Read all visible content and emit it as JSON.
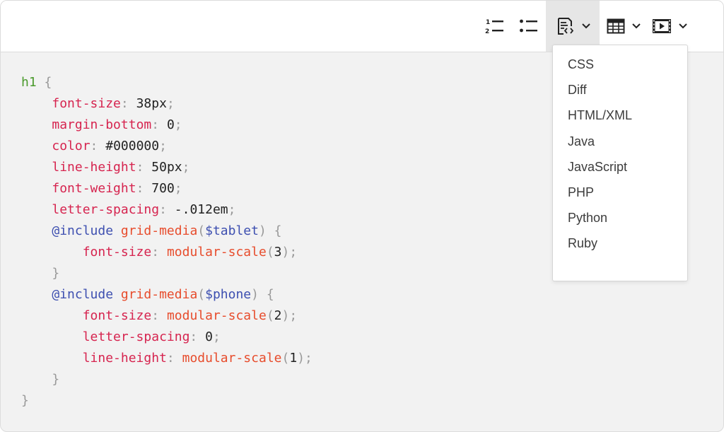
{
  "toolbar": {
    "buttons": [
      {
        "name": "numbered-list",
        "icon": "numbered-list-icon"
      },
      {
        "name": "bulleted-list",
        "icon": "bulleted-list-icon"
      },
      {
        "name": "code-block",
        "icon": "code-block-icon",
        "active": true,
        "dropdown": true
      },
      {
        "name": "table",
        "icon": "table-icon",
        "dropdown": true
      },
      {
        "name": "media",
        "icon": "media-icon",
        "dropdown": true
      }
    ]
  },
  "code_dropdown": {
    "languages": [
      "CSS",
      "Diff",
      "HTML/XML",
      "Java",
      "JavaScript",
      "PHP",
      "Python",
      "Ruby"
    ]
  },
  "code": {
    "lines": [
      [
        {
          "c": "sel",
          "t": "h1"
        },
        {
          "c": "pun",
          "t": " {"
        }
      ],
      [
        {
          "c": "",
          "t": "    "
        },
        {
          "c": "prop",
          "t": "font-size"
        },
        {
          "c": "pun",
          "t": ": "
        },
        {
          "c": "val",
          "t": "38px"
        },
        {
          "c": "pun",
          "t": ";"
        }
      ],
      [
        {
          "c": "",
          "t": "    "
        },
        {
          "c": "prop",
          "t": "margin-bottom"
        },
        {
          "c": "pun",
          "t": ": "
        },
        {
          "c": "val",
          "t": "0"
        },
        {
          "c": "pun",
          "t": ";"
        }
      ],
      [
        {
          "c": "",
          "t": "    "
        },
        {
          "c": "prop",
          "t": "color"
        },
        {
          "c": "pun",
          "t": ": "
        },
        {
          "c": "val",
          "t": "#000000"
        },
        {
          "c": "pun",
          "t": ";"
        }
      ],
      [
        {
          "c": "",
          "t": "    "
        },
        {
          "c": "prop",
          "t": "line-height"
        },
        {
          "c": "pun",
          "t": ": "
        },
        {
          "c": "val",
          "t": "50px"
        },
        {
          "c": "pun",
          "t": ";"
        }
      ],
      [
        {
          "c": "",
          "t": "    "
        },
        {
          "c": "prop",
          "t": "font-weight"
        },
        {
          "c": "pun",
          "t": ": "
        },
        {
          "c": "val",
          "t": "700"
        },
        {
          "c": "pun",
          "t": ";"
        }
      ],
      [
        {
          "c": "",
          "t": "    "
        },
        {
          "c": "prop",
          "t": "letter-spacing"
        },
        {
          "c": "pun",
          "t": ": "
        },
        {
          "c": "val",
          "t": "-.012em"
        },
        {
          "c": "pun",
          "t": ";"
        }
      ],
      [
        {
          "c": "",
          "t": "    "
        },
        {
          "c": "at",
          "t": "@include"
        },
        {
          "c": "",
          "t": " "
        },
        {
          "c": "fn",
          "t": "grid-media"
        },
        {
          "c": "pun",
          "t": "("
        },
        {
          "c": "var",
          "t": "$tablet"
        },
        {
          "c": "pun",
          "t": ") {"
        }
      ],
      [
        {
          "c": "",
          "t": "        "
        },
        {
          "c": "prop",
          "t": "font-size"
        },
        {
          "c": "pun",
          "t": ": "
        },
        {
          "c": "fn",
          "t": "modular-scale"
        },
        {
          "c": "pun",
          "t": "("
        },
        {
          "c": "val",
          "t": "3"
        },
        {
          "c": "pun",
          "t": ");"
        }
      ],
      [
        {
          "c": "",
          "t": "    "
        },
        {
          "c": "pun",
          "t": "}"
        }
      ],
      [
        {
          "c": "",
          "t": "    "
        },
        {
          "c": "at",
          "t": "@include"
        },
        {
          "c": "",
          "t": " "
        },
        {
          "c": "fn",
          "t": "grid-media"
        },
        {
          "c": "pun",
          "t": "("
        },
        {
          "c": "var",
          "t": "$phone"
        },
        {
          "c": "pun",
          "t": ") {"
        }
      ],
      [
        {
          "c": "",
          "t": "        "
        },
        {
          "c": "prop",
          "t": "font-size"
        },
        {
          "c": "pun",
          "t": ": "
        },
        {
          "c": "fn",
          "t": "modular-scale"
        },
        {
          "c": "pun",
          "t": "("
        },
        {
          "c": "val",
          "t": "2"
        },
        {
          "c": "pun",
          "t": ");"
        }
      ],
      [
        {
          "c": "",
          "t": "        "
        },
        {
          "c": "prop",
          "t": "letter-spacing"
        },
        {
          "c": "pun",
          "t": ": "
        },
        {
          "c": "val",
          "t": "0"
        },
        {
          "c": "pun",
          "t": ";"
        }
      ],
      [
        {
          "c": "",
          "t": "        "
        },
        {
          "c": "prop",
          "t": "line-height"
        },
        {
          "c": "pun",
          "t": ": "
        },
        {
          "c": "fn",
          "t": "modular-scale"
        },
        {
          "c": "pun",
          "t": "("
        },
        {
          "c": "val",
          "t": "1"
        },
        {
          "c": "pun",
          "t": ");"
        }
      ],
      [
        {
          "c": "",
          "t": "    "
        },
        {
          "c": "pun",
          "t": "}"
        }
      ],
      [
        {
          "c": "pun",
          "t": "}"
        }
      ]
    ]
  },
  "colors": {
    "selector": "#4a9a2c",
    "property": "#d6244f",
    "function": "#e74c2c",
    "at_rule": "#3d4fb0",
    "punctuation": "#999999",
    "value": "#222222",
    "editor_bg": "#f2f2f2",
    "toolbar_bg": "#ffffff",
    "active_button_bg": "#e6e6e6"
  }
}
